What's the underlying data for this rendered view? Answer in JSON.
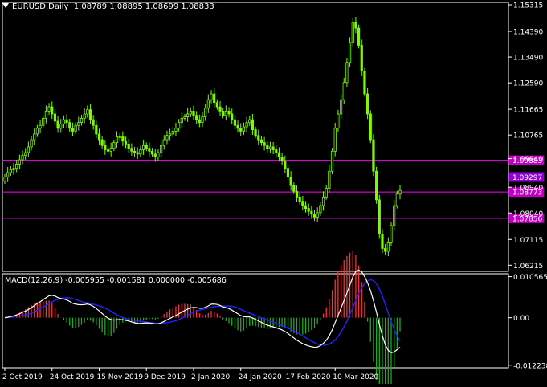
{
  "header": {
    "symbol": "EURUSD,Daily",
    "ohlc": "1.08789 1.08895 1.08699 1.08833"
  },
  "macd_header": "MACD(12,26,9) -0.005955 -0.001581 0.000000 -0.005686",
  "colors": {
    "background": "#000000",
    "grid_frame": "#ffffff",
    "candle": "#7cfc00",
    "hline": "#ff00ff",
    "label_magenta": "#c000c0",
    "label_purple": "#9400d3",
    "macd_pos": "#ff3030",
    "macd_neg": "#22aa22",
    "macd_line": "#ffffff",
    "signal_line": "#2222ff"
  },
  "icons": {
    "dropdown": "triangle-down-icon"
  },
  "chart_data": [
    {
      "type": "candlestick",
      "title": "EURUSD,Daily",
      "price_ticks": [
        "1.15315",
        "1.14390",
        "1.13490",
        "1.12590",
        "1.11665",
        "1.10765",
        "1.09940",
        "1.08940",
        "1.08040",
        "1.07115",
        "1.06215"
      ],
      "ylim": [
        1.06,
        1.154
      ],
      "date_ticks": [
        "2 Oct 2019",
        "24 Oct 2019",
        "15 Nov 2019",
        "9 Dec 2019",
        "2 Jan 2020",
        "24 Jan 2020",
        "17 Feb 2020",
        "10 Mar 2020"
      ],
      "horizontal_levels": [
        {
          "value": 1.09883,
          "label": "1.09883",
          "color": "magenta"
        },
        {
          "value": 1.09297,
          "label": "1.09297",
          "color": "purple"
        },
        {
          "value": 1.08773,
          "label": "1.08773",
          "color": "magenta"
        },
        {
          "value": 1.07856,
          "label": "1.07856",
          "color": "magenta"
        }
      ],
      "close": [
        1.093,
        1.0945,
        1.0955,
        1.096,
        1.0975,
        1.099,
        1.1005,
        1.1015,
        1.1035,
        1.106,
        1.108,
        1.11,
        1.111,
        1.1135,
        1.116,
        1.1175,
        1.115,
        1.1125,
        1.11,
        1.1115,
        1.113,
        1.112,
        1.11,
        1.109,
        1.111,
        1.112,
        1.1135,
        1.115,
        1.1165,
        1.113,
        1.111,
        1.108,
        1.106,
        1.104,
        1.1025,
        1.102,
        1.103,
        1.105,
        1.107,
        1.107,
        1.1055,
        1.1045,
        1.103,
        1.102,
        1.1015,
        1.101,
        1.1025,
        1.104,
        1.103,
        1.102,
        1.101,
        1.1,
        1.1015,
        1.104,
        1.106,
        1.1075,
        1.108,
        1.109,
        1.11,
        1.112,
        1.1135,
        1.114,
        1.115,
        1.116,
        1.1145,
        1.113,
        1.112,
        1.114,
        1.117,
        1.12,
        1.122,
        1.119,
        1.1175,
        1.116,
        1.1145,
        1.116,
        1.115,
        1.113,
        1.111,
        1.11,
        1.109,
        1.1105,
        1.112,
        1.113,
        1.1095,
        1.1075,
        1.106,
        1.105,
        1.104,
        1.103,
        1.1035,
        1.1025,
        1.1015,
        1.1,
        1.0985,
        1.096,
        1.093,
        1.09,
        1.088,
        1.086,
        1.0845,
        1.083,
        1.082,
        1.081,
        1.08,
        1.079,
        1.0805,
        1.083,
        1.086,
        1.089,
        1.095,
        1.102,
        1.11,
        1.115,
        1.12,
        1.126,
        1.133,
        1.14,
        1.147,
        1.145,
        1.139,
        1.13,
        1.122,
        1.115,
        1.106,
        1.095,
        1.085,
        1.073,
        1.068,
        1.067,
        1.07,
        1.076,
        1.083,
        1.087,
        1.0883
      ],
      "macd_panel": {
        "title": "MACD(12,26,9)",
        "values": [
          -0.005955,
          -0.001581,
          0.0,
          -0.005686
        ],
        "ticks": [
          "0.010565",
          "0.00",
          "-0.012238"
        ],
        "ylim": [
          -0.0129,
          0.0113
        ]
      }
    }
  ]
}
